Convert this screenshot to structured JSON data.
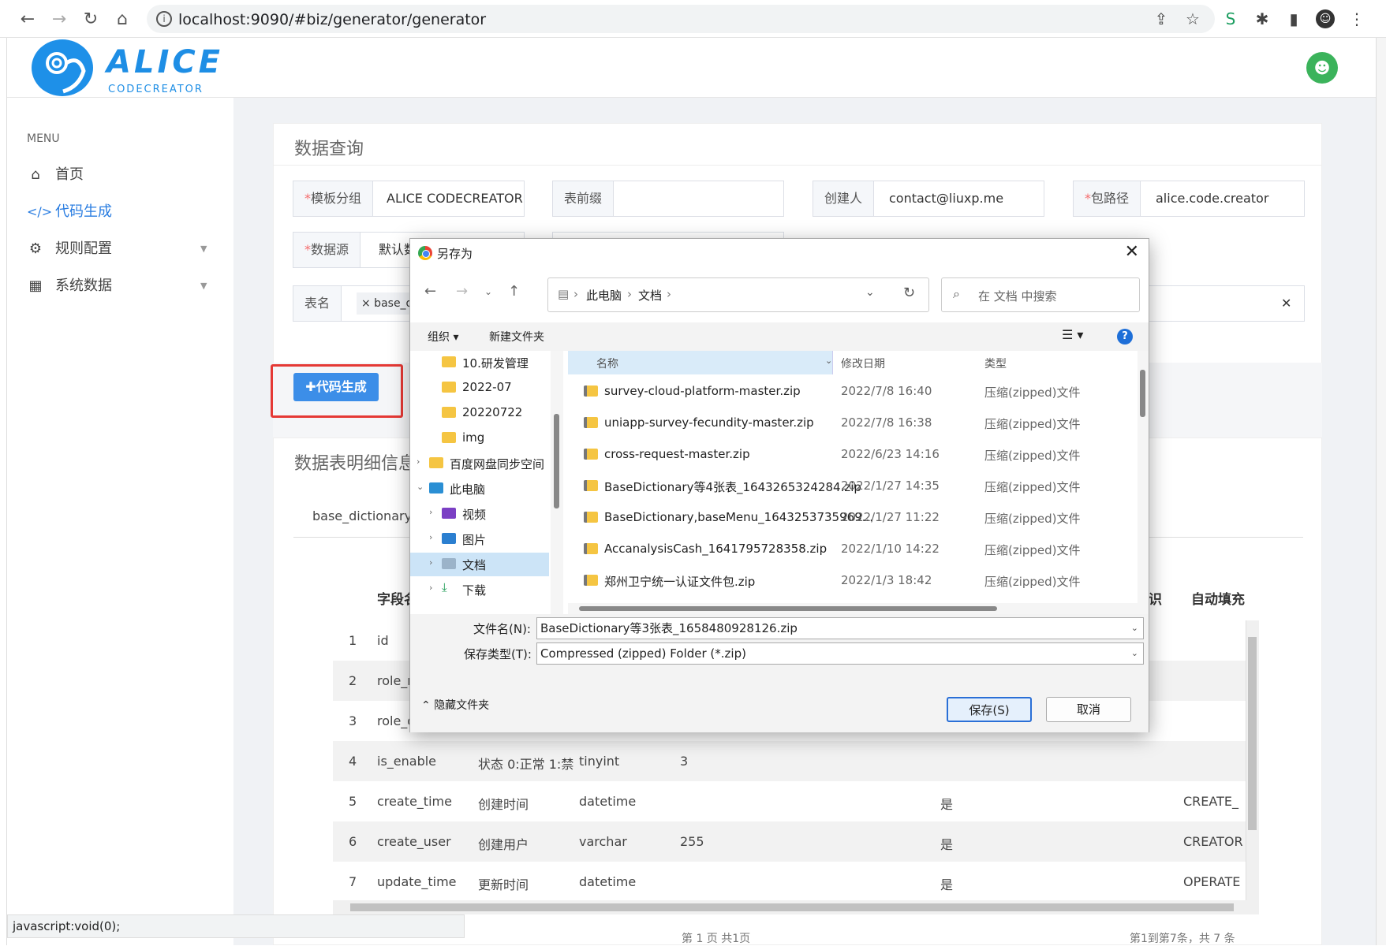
{
  "browser": {
    "url": "localhost:9090/#biz/generator/generator"
  },
  "brand": {
    "name": "ALICE",
    "sub": "CODECREATOR"
  },
  "sidebar": {
    "menu_heading": "MENU",
    "items": [
      {
        "label": "首页",
        "icon": "home-icon"
      },
      {
        "label": "代码生成",
        "icon": "code-icon",
        "active": true
      },
      {
        "label": "规则配置",
        "icon": "gear-icon"
      },
      {
        "label": "系统数据",
        "icon": "building-icon"
      }
    ]
  },
  "query_panel": {
    "title": "数据查询",
    "fields": [
      {
        "required": "*",
        "label": "模板分组",
        "value": "ALICE CODECREATOR"
      },
      {
        "required": "",
        "label": "表前缀",
        "value": ""
      },
      {
        "required": "",
        "label": "创建人",
        "value": "contact@liuxp.me"
      },
      {
        "required": "*",
        "label": "包路径",
        "value": "alice.code.creator"
      },
      {
        "required": "*",
        "label": "数据源",
        "value": "默认数"
      },
      {
        "required": "",
        "label": "表名",
        "value": "× base_d"
      }
    ],
    "clear_label": "✕"
  },
  "generate_button": "✚代码生成",
  "detail_panel": {
    "title": "数据表明细信息",
    "tab": "base_dictionary",
    "headers": [
      "字段名",
      "识",
      "自动填充"
    ],
    "rows": [
      {
        "n": "1",
        "name": "id",
        "c": "",
        "t": "",
        "len": "",
        "k": "",
        "fill": ""
      },
      {
        "n": "2",
        "name": "role_n",
        "c": "",
        "t": "",
        "len": "",
        "k": "",
        "fill": ""
      },
      {
        "n": "3",
        "name": "role_d",
        "c": "",
        "t": "",
        "len": "",
        "k": "",
        "fill": ""
      },
      {
        "n": "4",
        "name": "is_enable",
        "c": "状态 0:正常 1:禁",
        "t": "tinyint",
        "len": "3",
        "k": "",
        "fill": ""
      },
      {
        "n": "5",
        "name": "create_time",
        "c": "创建时间",
        "t": "datetime",
        "len": "",
        "k": "是",
        "fill": "CREATE_"
      },
      {
        "n": "6",
        "name": "create_user",
        "c": "创建用户",
        "t": "varchar",
        "len": "255",
        "k": "是",
        "fill": "CREATOR"
      },
      {
        "n": "7",
        "name": "update_time",
        "c": "更新时间",
        "t": "datetime",
        "len": "",
        "k": "是",
        "fill": "OPERATE"
      }
    ],
    "pager_left": "第 1 页 共1页",
    "pager_right": "第1到第7条，共 7 条"
  },
  "status_bar": "javascript:void(0);",
  "dialog": {
    "title": "另存为",
    "path": [
      "此电脑",
      "文档"
    ],
    "search_placeholder": "在 文档 中搜索",
    "toolbar": {
      "organize": "组织 ▾",
      "new_folder": "新建文件夹"
    },
    "tree": [
      {
        "label": "10.研发管理",
        "indent": 1
      },
      {
        "label": "2022-07",
        "indent": 1
      },
      {
        "label": "20220722",
        "indent": 1
      },
      {
        "label": "img",
        "indent": 1
      },
      {
        "label": "百度网盘同步空间",
        "indent": 0
      },
      {
        "label": "此电脑",
        "indent": 0
      },
      {
        "label": "视频",
        "indent": 1
      },
      {
        "label": "图片",
        "indent": 1
      },
      {
        "label": "文档",
        "indent": 1,
        "selected": true
      },
      {
        "label": "下载",
        "indent": 1
      }
    ],
    "columns": [
      "名称",
      "修改日期",
      "类型"
    ],
    "files": [
      {
        "name": "survey-cloud-platform-master.zip",
        "date": "2022/7/8 16:40",
        "type": "压缩(zipped)文件"
      },
      {
        "name": "uniapp-survey-fecundity-master.zip",
        "date": "2022/7/8 16:38",
        "type": "压缩(zipped)文件"
      },
      {
        "name": "cross-request-master.zip",
        "date": "2022/6/23 14:16",
        "type": "压缩(zipped)文件"
      },
      {
        "name": "BaseDictionary等4张表_1643265324284.zip",
        "date": "2022/1/27 14:35",
        "type": "压缩(zipped)文件"
      },
      {
        "name": "BaseDictionary,baseMenu_1643253735969...",
        "date": "2022/1/27 11:22",
        "type": "压缩(zipped)文件"
      },
      {
        "name": "AccanalysisCash_1641795728358.zip",
        "date": "2022/1/10 14:22",
        "type": "压缩(zipped)文件"
      },
      {
        "name": "郑州卫宁统一认证文件包.zip",
        "date": "2022/1/3 18:42",
        "type": "压缩(zipped)文件"
      }
    ],
    "filename_label": "文件名(N):",
    "filename_value": "BaseDictionary等3张表_1658480928126.zip",
    "filetype_label": "保存类型(T):",
    "filetype_value": "Compressed (zipped) Folder (*.zip)",
    "hide_folders": "隐藏文件夹",
    "save": "保存(S)",
    "cancel": "取消"
  }
}
